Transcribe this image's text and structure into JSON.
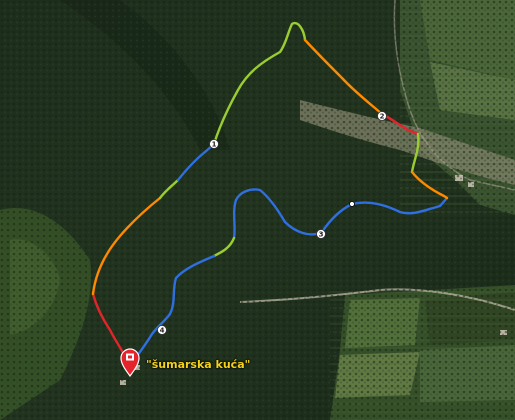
{
  "map": {
    "type": "satellite",
    "poi": {
      "label": "\"šumarska kuća\"",
      "icon": "map-pin-icon",
      "pin_color": "#e4232b"
    },
    "route_colors": {
      "slow": "#2f6fe0",
      "medium": "#9acd32",
      "fast": "#ff8a00",
      "fastest": "#e0262b"
    },
    "km_markers": [
      "1",
      "2",
      "3",
      "4"
    ],
    "background_colors": {
      "forest_dark": "#1b2b1b",
      "forest": "#273a22",
      "field": "#3e5a2c",
      "field_light": "#6a7e4a",
      "road": "#b9b3a0"
    }
  }
}
